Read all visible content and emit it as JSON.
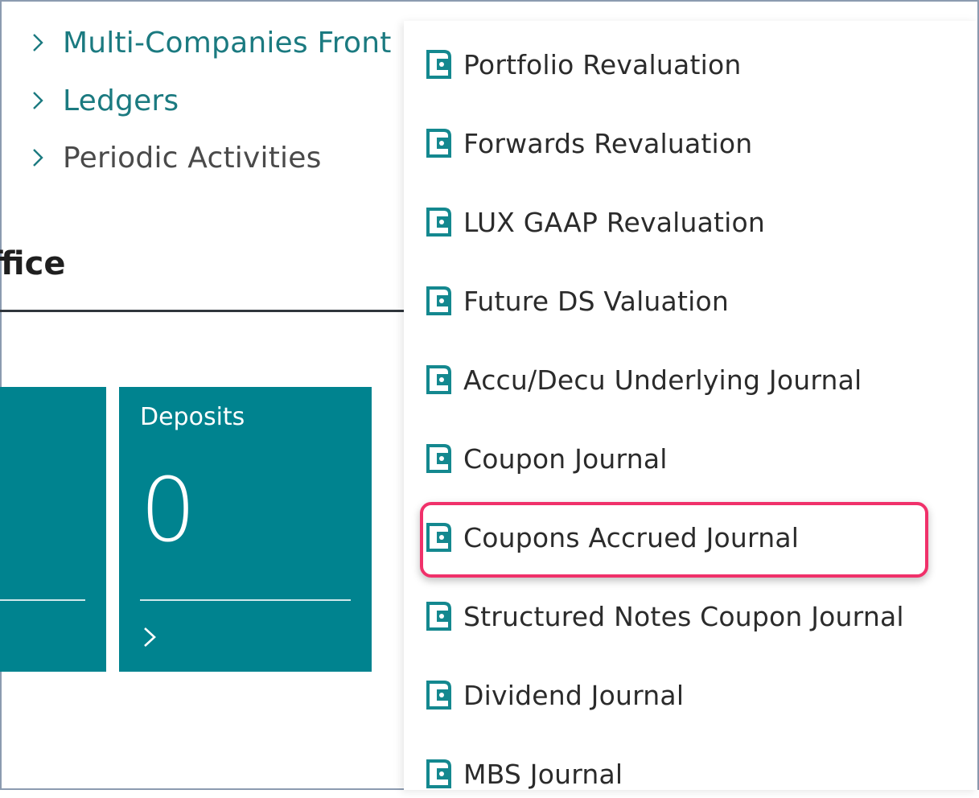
{
  "nav": {
    "items": [
      {
        "label": "Multi-Companies Front",
        "style": "link"
      },
      {
        "label": "Ledgers",
        "style": "link"
      },
      {
        "label": "Periodic Activities",
        "style": "plain"
      }
    ]
  },
  "section": {
    "title": "ffice"
  },
  "tiles": [
    {
      "title": "",
      "value": ""
    },
    {
      "title": "Deposits",
      "value": "0"
    }
  ],
  "menu": {
    "items": [
      {
        "label": "Portfolio Revaluation",
        "icon": "report-icon"
      },
      {
        "label": "Forwards Revaluation",
        "icon": "report-icon"
      },
      {
        "label": "LUX GAAP Revaluation",
        "icon": "report-icon"
      },
      {
        "label": "Future DS Valuation",
        "icon": "report-icon"
      },
      {
        "label": "Accu/Decu Underlying Journal",
        "icon": "report-icon"
      },
      {
        "label": "Coupon Journal",
        "icon": "report-icon"
      },
      {
        "label": "Coupons Accrued Journal",
        "icon": "report-icon",
        "highlighted": true
      },
      {
        "label": "Structured Notes Coupon Journal",
        "icon": "report-icon"
      },
      {
        "label": "Dividend Journal",
        "icon": "report-icon"
      },
      {
        "label": "MBS Journal",
        "icon": "report-icon"
      }
    ]
  },
  "colors": {
    "accent": "#00838f",
    "link": "#1b7a80",
    "highlight": "#f0316a"
  }
}
